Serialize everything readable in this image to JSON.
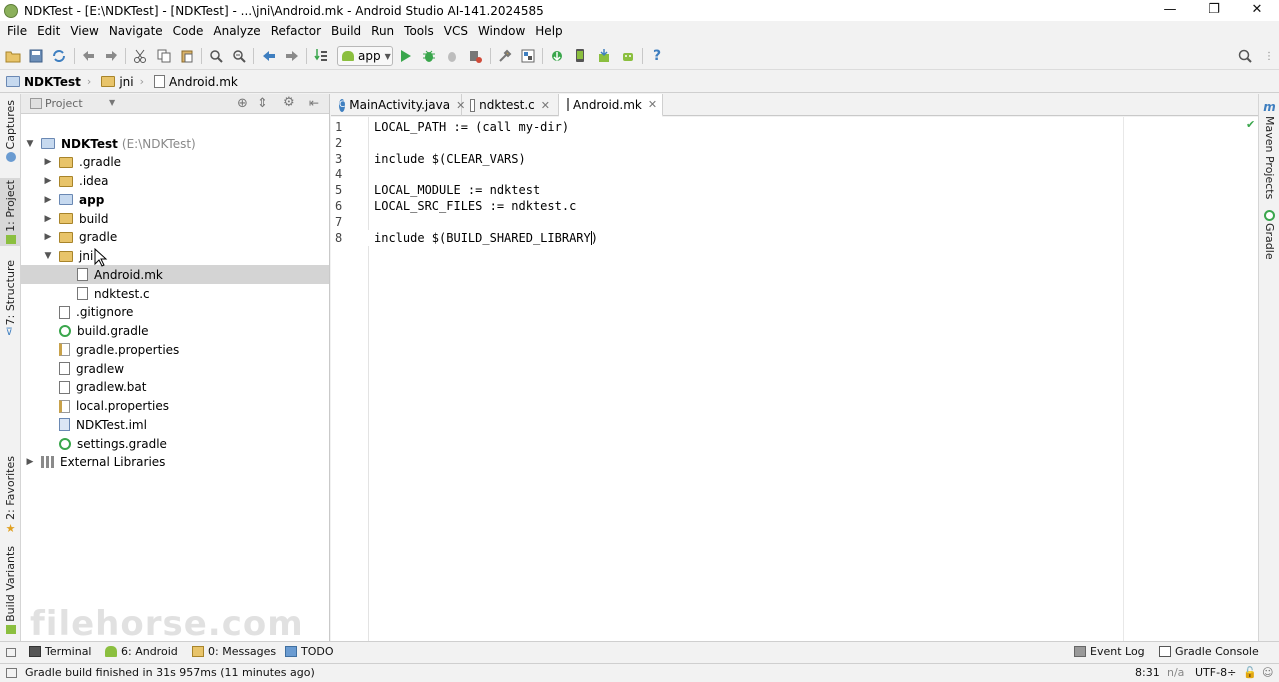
{
  "window": {
    "title": "NDKTest - [E:\\NDKTest] - [NDKTest] - ...\\jni\\Android.mk - Android Studio AI-141.2024585",
    "minimize": "—",
    "maximize": "❐",
    "close": "✕"
  },
  "menu": [
    "File",
    "Edit",
    "View",
    "Navigate",
    "Code",
    "Analyze",
    "Refactor",
    "Build",
    "Run",
    "Tools",
    "VCS",
    "Window",
    "Help"
  ],
  "toolbar": {
    "run_config": "app"
  },
  "breadcrumb": [
    "NDKTest",
    "jni",
    "Android.mk"
  ],
  "left_tool_tabs": [
    "Captures",
    "1: Project",
    "7: Structure",
    "2: Favorites",
    "Build Variants"
  ],
  "right_tool_tabs": [
    "Maven Projects",
    "Gradle"
  ],
  "project_panel": {
    "view_label": "Project",
    "tree": [
      {
        "label": "NDKTest",
        "sub": "(E:\\NDKTest)",
        "type": "module",
        "depth": 0,
        "expanded": true,
        "bold": true
      },
      {
        "label": ".gradle",
        "type": "folder",
        "depth": 1,
        "expanded": false
      },
      {
        "label": ".idea",
        "type": "folder",
        "depth": 1,
        "expanded": false
      },
      {
        "label": "app",
        "type": "module-folder",
        "depth": 1,
        "expanded": false,
        "bold": true
      },
      {
        "label": "build",
        "type": "folder",
        "depth": 1,
        "expanded": false
      },
      {
        "label": "gradle",
        "type": "folder",
        "depth": 1,
        "expanded": false
      },
      {
        "label": "jni",
        "type": "folder",
        "depth": 1,
        "expanded": true
      },
      {
        "label": "Android.mk",
        "type": "file",
        "depth": 2,
        "selected": true
      },
      {
        "label": "ndktest.c",
        "type": "file",
        "depth": 2
      },
      {
        "label": ".gitignore",
        "type": "file",
        "depth": 1
      },
      {
        "label": "build.gradle",
        "type": "gradle",
        "depth": 1
      },
      {
        "label": "gradle.properties",
        "type": "props",
        "depth": 1
      },
      {
        "label": "gradlew",
        "type": "file",
        "depth": 1
      },
      {
        "label": "gradlew.bat",
        "type": "file",
        "depth": 1
      },
      {
        "label": "local.properties",
        "type": "props",
        "depth": 1
      },
      {
        "label": "NDKTest.iml",
        "type": "iml",
        "depth": 1
      },
      {
        "label": "settings.gradle",
        "type": "gradle",
        "depth": 1
      },
      {
        "label": "External Libraries",
        "type": "libs",
        "depth": 0,
        "expanded": false
      }
    ]
  },
  "editor": {
    "tabs": [
      {
        "label": "MainActivity.java",
        "icon": "C",
        "active": false
      },
      {
        "label": "ndktest.c",
        "icon": "file",
        "active": false
      },
      {
        "label": "Android.mk",
        "icon": "file",
        "active": true
      }
    ],
    "lines": [
      "LOCAL_PATH := (call my-dir)",
      "",
      "include $(CLEAR_VARS)",
      "",
      "LOCAL_MODULE := ndktest",
      "LOCAL_SRC_FILES := ndktest.c",
      "",
      "include $(BUILD_SHARED_LIBRARY)"
    ],
    "line_numbers": [
      "1",
      "2",
      "3",
      "4",
      "5",
      "6",
      "7",
      "8"
    ]
  },
  "bottom_tabs": {
    "left": [
      "Terminal",
      "6: Android",
      "0: Messages",
      "TODO"
    ],
    "right": [
      "Event Log",
      "Gradle Console"
    ]
  },
  "status": {
    "message": "Gradle build finished in 31s 957ms (11 minutes ago)",
    "position": "8:31",
    "separator": "n/a",
    "encoding": "UTF-8÷"
  },
  "watermark": "filehorse.com",
  "colors": {
    "accent": "#3f7fc0",
    "gradle_green": "#3aa64c",
    "folder": "#e8c46a",
    "selection": "#d4d4d4"
  }
}
